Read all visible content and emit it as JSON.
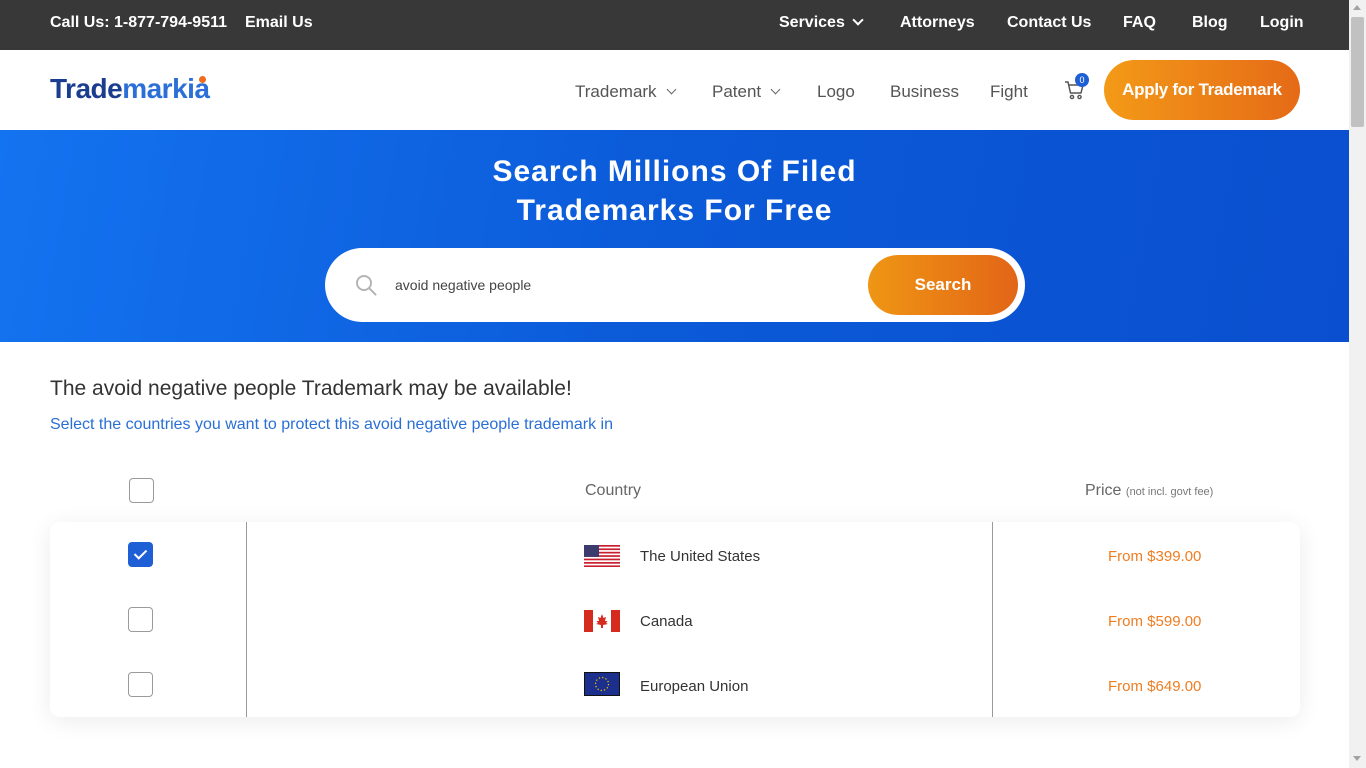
{
  "topbar": {
    "call": "Call Us: 1-877-794-9511",
    "email": "Email Us",
    "services": "Services",
    "attorneys": "Attorneys",
    "contact": "Contact Us",
    "faq": "FAQ",
    "blog": "Blog",
    "login": "Login"
  },
  "logo": {
    "part1": "Trade",
    "part2": "markia"
  },
  "nav": {
    "trademark": "Trademark",
    "patent": "Patent",
    "logo": "Logo",
    "business": "Business",
    "fight": "Fight",
    "cart_count": "0",
    "apply": "Apply for Trademark"
  },
  "hero": {
    "title_line1": "Search Millions Of Filed",
    "title_line2": "Trademarks For Free",
    "search_value": "avoid negative people",
    "search_button": "Search"
  },
  "results": {
    "title": "The avoid negative people Trademark may be available!",
    "subtitle": "Select the countries you want to protect this avoid negative people trademark in",
    "col_country": "Country",
    "col_price": "Price",
    "col_price_note": "(not incl. govt fee)",
    "rows": [
      {
        "country": "The United States",
        "price": "From $399.00",
        "checked": true,
        "flag": "us-flag"
      },
      {
        "country": "Canada",
        "price": "From $599.00",
        "checked": false,
        "flag": "canada-flag"
      },
      {
        "country": "European Union",
        "price": "From $649.00",
        "checked": false,
        "flag": "eu-flag"
      }
    ]
  },
  "colors": {
    "topbar_bg": "#383838",
    "hero_blue": "#0b5ad8",
    "accent_orange": "#ef7d22",
    "link_blue": "#2a6fd6",
    "checkbox_blue": "#1f5fd6"
  },
  "icons": [
    "chevron-down-icon",
    "cart-icon",
    "search-icon",
    "check-icon"
  ]
}
